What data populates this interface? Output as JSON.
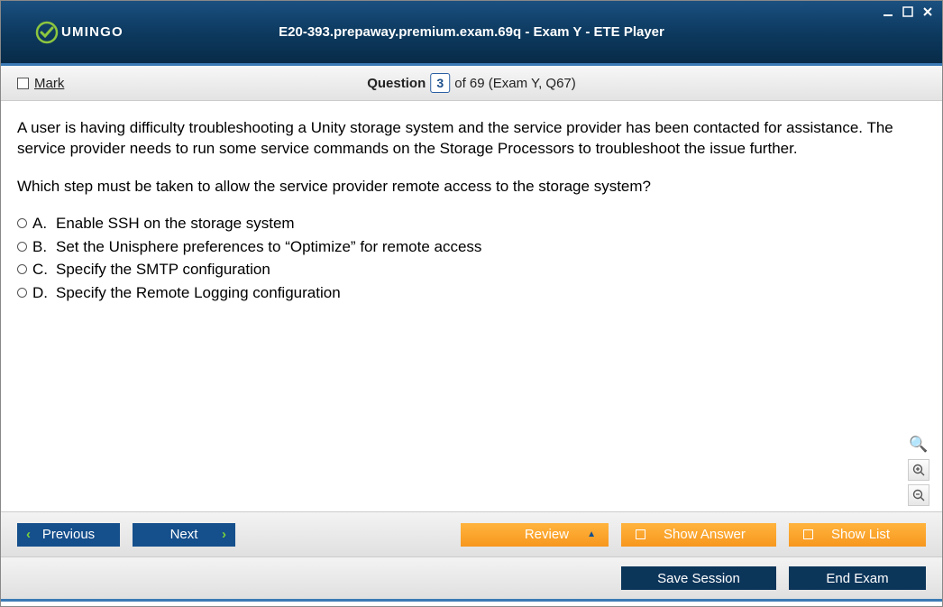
{
  "window": {
    "title": "E20-393.prepaway.premium.exam.69q - Exam Y - ETE Player",
    "logo": "UMINGO"
  },
  "toolbar": {
    "mark_label": "Mark",
    "q_word": "Question",
    "q_num": "3",
    "q_suffix": " of 69 (Exam Y, Q67)"
  },
  "question": {
    "p1": "A user is having difficulty troubleshooting a Unity storage system and the service provider has been contacted for assistance. The service provider needs to run some service commands on the Storage Processors to troubleshoot the issue further.",
    "p2": "Which step must be taken to allow the service provider remote access to the storage system?",
    "options": [
      {
        "letter": "A.",
        "text": "Enable SSH on the storage system"
      },
      {
        "letter": "B.",
        "text": "Set the Unisphere preferences to “Optimize” for remote access"
      },
      {
        "letter": "C.",
        "text": "Specify the SMTP configuration"
      },
      {
        "letter": "D.",
        "text": "Specify the Remote Logging configuration"
      }
    ]
  },
  "buttons": {
    "previous": "Previous",
    "next": "Next",
    "review": "Review",
    "show_answer": "Show Answer",
    "show_list": "Show List",
    "save_session": "Save Session",
    "end_exam": "End Exam"
  }
}
